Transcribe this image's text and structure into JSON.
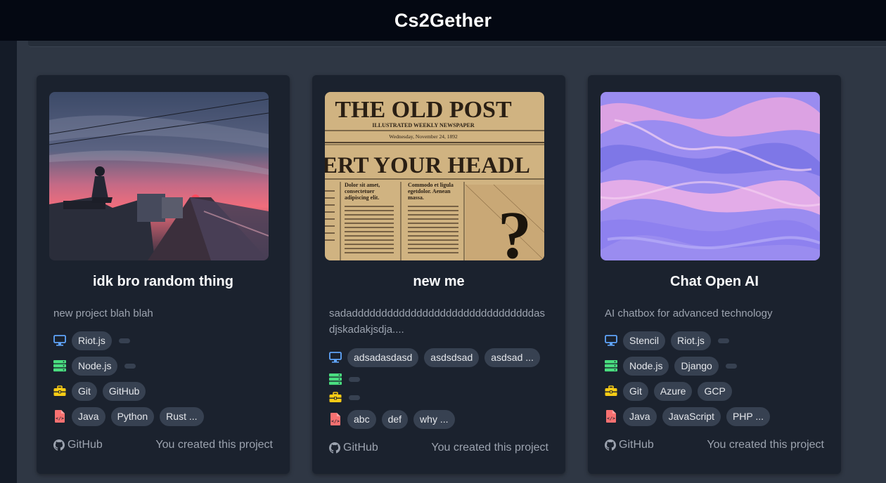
{
  "app": {
    "title": "Cs2Gether"
  },
  "cards": [
    {
      "title": "idk bro random thing",
      "description": "new project blah blah",
      "frontend": [
        "Riot.js"
      ],
      "backend": [
        "Node.js"
      ],
      "tools": [
        "Git",
        "GitHub"
      ],
      "languages": [
        "Java",
        "Python",
        "Rust ..."
      ],
      "footer_link": "GitHub",
      "footer_status": "You created this project"
    },
    {
      "title": "new me",
      "description": "sadadddddddddddddddddddddddddddddddasdjskadakjsdja....",
      "image_text": {
        "masthead": "THE OLD POST",
        "subtitle": "ILLUSTRATED WEEKLY NEWSPAPER",
        "date": "Wednesday, November 24, 1892",
        "headline": "ERT YOUR HEADL",
        "col1": "Dolor sit amet, consectetuer adipiscing elit.",
        "col2": "Commodo et ligula egetdolor. Aenean massa.",
        "mark": "?"
      },
      "frontend": [
        "adsadasdasd",
        "asdsdsad",
        "asdsad ..."
      ],
      "backend": [],
      "tools": [],
      "languages": [
        "abc",
        "def",
        "why ..."
      ],
      "footer_link": "GitHub",
      "footer_status": "You created this project"
    },
    {
      "title": "Chat Open AI",
      "description": "AI chatbox for advanced technology",
      "frontend": [
        "Stencil",
        "Riot.js"
      ],
      "backend": [
        "Node.js",
        "Django"
      ],
      "tools": [
        "Git",
        "Azure",
        "GCP"
      ],
      "languages": [
        "Java",
        "JavaScript",
        "PHP ..."
      ],
      "footer_link": "GitHub",
      "footer_status": "You created this project"
    }
  ],
  "icons": {
    "frontend": "monitor-icon",
    "backend": "server-icon",
    "tools": "toolbox-icon",
    "languages": "code-file-icon",
    "footer": "github-icon"
  },
  "colors": {
    "monitor": "#60a5fa",
    "server": "#4ade80",
    "toolbox": "#facc15",
    "code_file": "#f87171"
  }
}
